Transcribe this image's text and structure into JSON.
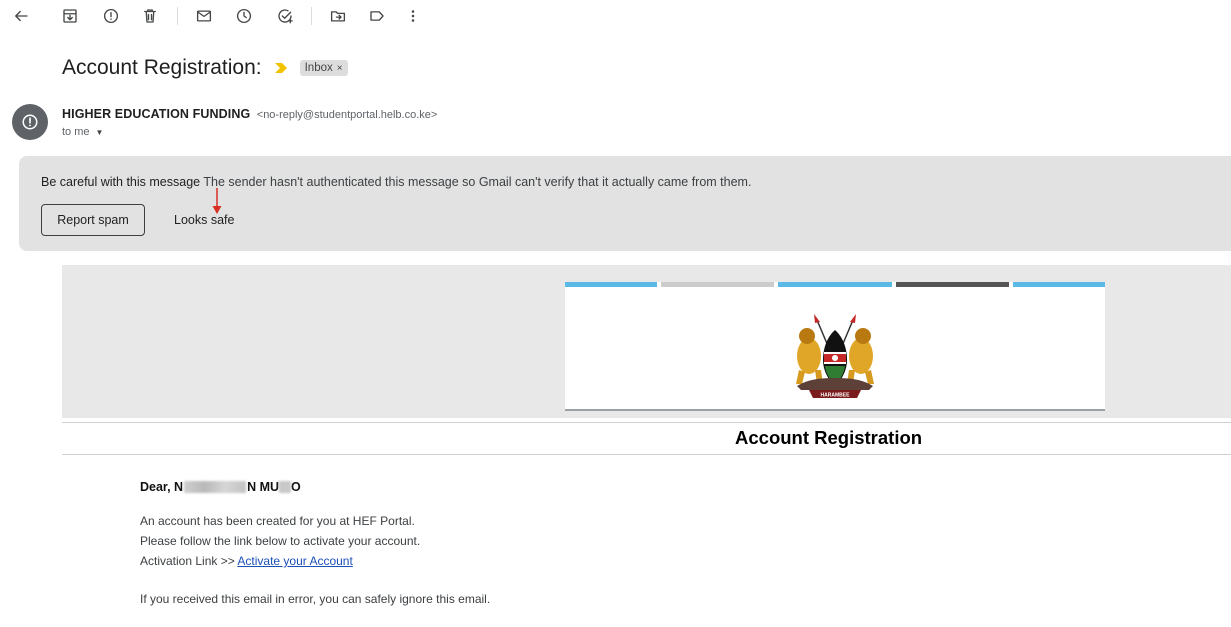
{
  "toolbar": {
    "icons": [
      "back-arrow-icon",
      "archive-icon",
      "report-spam-icon",
      "delete-icon",
      "mark-unread-icon",
      "snooze-icon",
      "add-task-icon",
      "move-to-icon",
      "label-icon",
      "more-options-icon"
    ]
  },
  "subject": {
    "text": "Account Registration:",
    "label_chip": "Inbox",
    "chip_close": "×"
  },
  "sender": {
    "name": "HIGHER EDUCATION FUNDING",
    "email": "<no-reply@studentportal.helb.co.ke>",
    "to": "to me"
  },
  "warning": {
    "title": "Be careful with this message",
    "message": " The sender hasn't authenticated this message so Gmail can't verify that it actually came from them.",
    "report_spam": "Report spam",
    "looks_safe": "Looks safe"
  },
  "email": {
    "stripe_colors": [
      "#5ab9e6",
      "#cccccc",
      "#5ab9e6",
      "#555555",
      "#5ab9e6"
    ],
    "heading": "Account Registration",
    "greeting_start": "Dear, N",
    "greeting_mid": "N MU",
    "greeting_end": "O",
    "line1": "An account has been created for you at HEF Portal.",
    "line2": "Please follow the link below to activate your account.",
    "activation_prefix": "Activation Link >> ",
    "activation_link": "Activate your Account",
    "footer": "If you received this email in error, you can safely ignore this email."
  },
  "colors": {
    "warning_bg": "#e2e2e2",
    "link": "#1a4fb8",
    "arrow": "#d93025",
    "importance": "#f2c200"
  }
}
